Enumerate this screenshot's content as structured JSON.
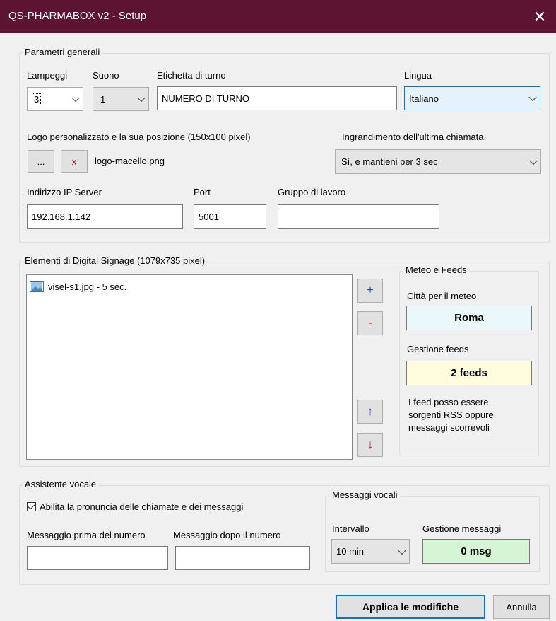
{
  "window": {
    "title": "QS-PHARMABOX v2 - Setup",
    "close_glyph": "✕"
  },
  "general": {
    "legend": "Parametri generali",
    "lampeggi": {
      "label": "Lampeggi",
      "value": "3"
    },
    "suono": {
      "label": "Suono",
      "value": "1"
    },
    "etichetta": {
      "label": "Etichetta di turno",
      "value": "NUMERO DI TURNO"
    },
    "lingua": {
      "label": "Lingua",
      "value": "Italiano"
    },
    "logo": {
      "label": "Logo personalizzato e la sua posizione (150x100 pixel)",
      "browse": "...",
      "remove": "x",
      "file": "logo-macello.png"
    },
    "ingrandimento": {
      "label": "Ingrandimento dell'ultima chiamata",
      "value": "Sì, e mantieni per 3 sec"
    },
    "ip": {
      "label": "Indirizzo IP Server",
      "value": "192.168.1.142"
    },
    "port": {
      "label": "Port",
      "value": "5001"
    },
    "gruppo": {
      "label": "Gruppo di lavoro",
      "value": ""
    }
  },
  "signage": {
    "legend": "Elementi di Digital Signage (1079x735 pixel)",
    "items": [
      {
        "text": "visel-s1.jpg - 5 sec.",
        "icon": "image-icon"
      }
    ],
    "add": "+",
    "remove": "-",
    "up": "↑",
    "down": "↓"
  },
  "meteo": {
    "legend": "Meteo e Feeds",
    "city_label": "Città per il meteo",
    "city": "Roma",
    "feeds_label": "Gestione feeds",
    "feeds": "2 feeds",
    "note": "I feed posso essere sorgenti RSS oppure messaggi scorrevoli"
  },
  "voice": {
    "legend": "Assistente vocale",
    "enable_label": "Abilita la pronuncia delle chiamate e dei messaggi",
    "enabled": true,
    "before_label": "Messaggio prima del numero",
    "after_label": "Messaggio dopo il numero",
    "before_value": "",
    "after_value": ""
  },
  "vocal_msgs": {
    "legend": "Messaggi vocali",
    "interval_label": "Intervallo",
    "interval_value": "10 min",
    "manage_label": "Gestione messaggi",
    "manage_value": "0 msg"
  },
  "footer": {
    "apply": "Applica le modifiche",
    "cancel": "Annulla"
  },
  "colors": {
    "titlebar": "#5c1432",
    "city_bg": "#eaf8fb",
    "feeds_bg": "#fffbdc",
    "msg_bg": "#d5f5d5",
    "accent": "#0078d7"
  }
}
